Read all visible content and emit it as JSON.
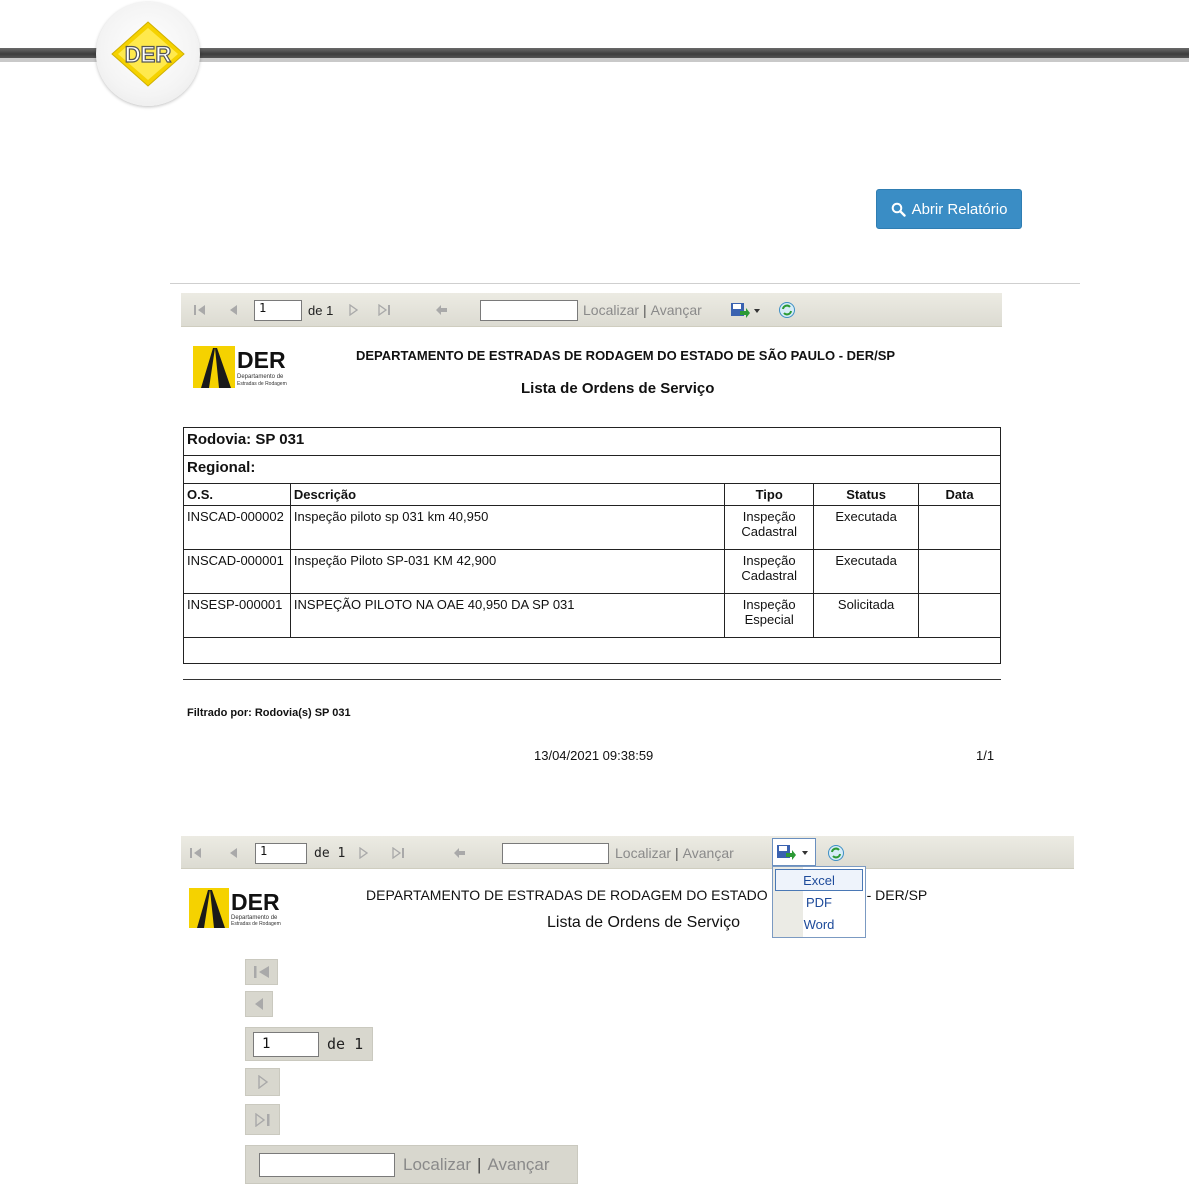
{
  "header": {
    "logo_text": "DER"
  },
  "open_report_button": {
    "label": "Abrir Relatório",
    "icon": "search-icon"
  },
  "toolbar": {
    "page_value": "1",
    "of_label": "de 1",
    "find_placeholder": "",
    "find_label": "Localizar",
    "separator": "|",
    "next_label": "Avançar"
  },
  "report": {
    "logo_brand": "DER",
    "logo_sub1": "Departamento de",
    "logo_sub2": "Estradas de Rodagem",
    "title": "DEPARTAMENTO DE ESTRADAS DE RODAGEM DO ESTADO DE SÃO PAULO - DER/SP",
    "subtitle": "Lista de Ordens de Serviço",
    "rodovia_label": "Rodovia: SP 031",
    "regional_label": "Regional:",
    "columns": [
      "O.S.",
      "Descrição",
      "Tipo",
      "Status",
      "Data"
    ],
    "rows": [
      {
        "os": "INSCAD-000002",
        "descricao": "Inspeção piloto sp 031 km 40,950",
        "tipo1": "Inspeção",
        "tipo2": "Cadastral",
        "status": "Executada",
        "data": ""
      },
      {
        "os": "INSCAD-000001",
        "descricao": "Inspeção Piloto SP-031 KM 42,900",
        "tipo1": "Inspeção",
        "tipo2": "Cadastral",
        "status": "Executada",
        "data": ""
      },
      {
        "os": "INSESP-000001",
        "descricao": "INSPEÇÃO PILOTO NA OAE 40,950 DA SP 031",
        "tipo1": "Inspeção",
        "tipo2": "Especial",
        "status": "Solicitada",
        "data": ""
      }
    ],
    "filtered_by": "Filtrado por: Rodovia(s) SP 031",
    "timestamp": "13/04/2021 09:38:59",
    "page_count": "1/1"
  },
  "second_view": {
    "title_left": "DEPARTAMENTO DE ESTRADAS DE RODAGEM DO ESTADO",
    "title_right": "- DER/SP",
    "subtitle": "Lista de Ordens de Serviço",
    "export_menu": [
      "Excel",
      "PDF",
      "Word"
    ],
    "title_hidden_fragment": ")"
  },
  "zoom": {
    "page_value": "1",
    "of_label": "de 1",
    "find_label": "Localizar",
    "separator": "|",
    "next_label": "Avançar"
  },
  "colors": {
    "primary_button": "#3a8dc5",
    "toolbar_bg": "#dcdbd2",
    "logo_yellow": "#f5d200"
  }
}
